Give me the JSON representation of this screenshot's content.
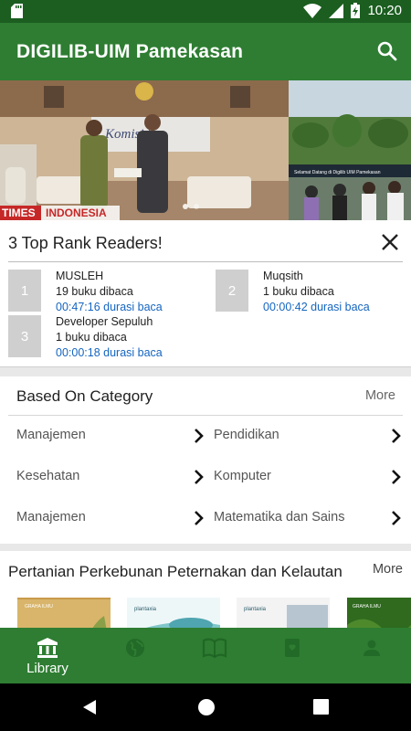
{
  "status_bar": {
    "time": "10:20",
    "icons": [
      "sd-card-icon",
      "wifi-icon",
      "signal-icon",
      "battery-charging-icon"
    ]
  },
  "app_bar": {
    "title": "DIGILIB-UIM Pamekasan",
    "search_icon": "search-icon"
  },
  "banner": {
    "slide1_caption_part1": "TIMES",
    "slide1_caption_part2": "INDONESIA",
    "slide1_sign_text": "Komisi 7",
    "slide2_banner_text": "Selamat Datang di Digilib UIM Pamekasan"
  },
  "top_rank": {
    "title": "3 Top Rank Readers!",
    "close_icon": "close-icon",
    "readers": [
      {
        "rank": "1",
        "name": "MUSLEH",
        "books": "19 buku dibaca",
        "duration": "00:47:16 durasi baca"
      },
      {
        "rank": "2",
        "name": "Muqsith",
        "books": "1 buku dibaca",
        "duration": "00:00:42 durasi baca"
      },
      {
        "rank": "3",
        "name": "Developer Sepuluh",
        "books": "1 buku dibaca",
        "duration": "00:00:18 durasi baca"
      }
    ],
    "colors": {
      "duration": "#1565c0",
      "rank_box": "#cfcfcf"
    }
  },
  "category": {
    "title": "Based On Category",
    "more": "More",
    "items": [
      {
        "label": "Manajemen"
      },
      {
        "label": "Pendidikan"
      },
      {
        "label": "Kesehatan"
      },
      {
        "label": "Komputer"
      },
      {
        "label": "Manajemen"
      },
      {
        "label": "Matematika dan Sains"
      }
    ]
  },
  "collection": {
    "title": "Pertanian Perkebunan Peternakan dan Kelautan",
    "more": "More",
    "books": [
      {
        "cover_label": "GRAHA ILMU"
      },
      {
        "cover_label": "plantaxia"
      },
      {
        "cover_label": "plantaxia"
      },
      {
        "cover_label": "GRAHA ILMU"
      }
    ]
  },
  "bottom_nav": {
    "items": [
      {
        "label": "Library",
        "icon": "library-icon",
        "active": true
      },
      {
        "label": "",
        "icon": "globe-icon",
        "active": false
      },
      {
        "label": "",
        "icon": "book-open-icon",
        "active": false
      },
      {
        "label": "",
        "icon": "favorite-book-icon",
        "active": false
      },
      {
        "label": "",
        "icon": "person-icon",
        "active": false
      }
    ]
  },
  "system_nav": {
    "icons": [
      "back-icon",
      "home-icon",
      "recents-icon"
    ]
  },
  "colors": {
    "primary": "#2e7d32",
    "primary_dark": "#1b5e20",
    "accent_text": "#1565c0"
  }
}
